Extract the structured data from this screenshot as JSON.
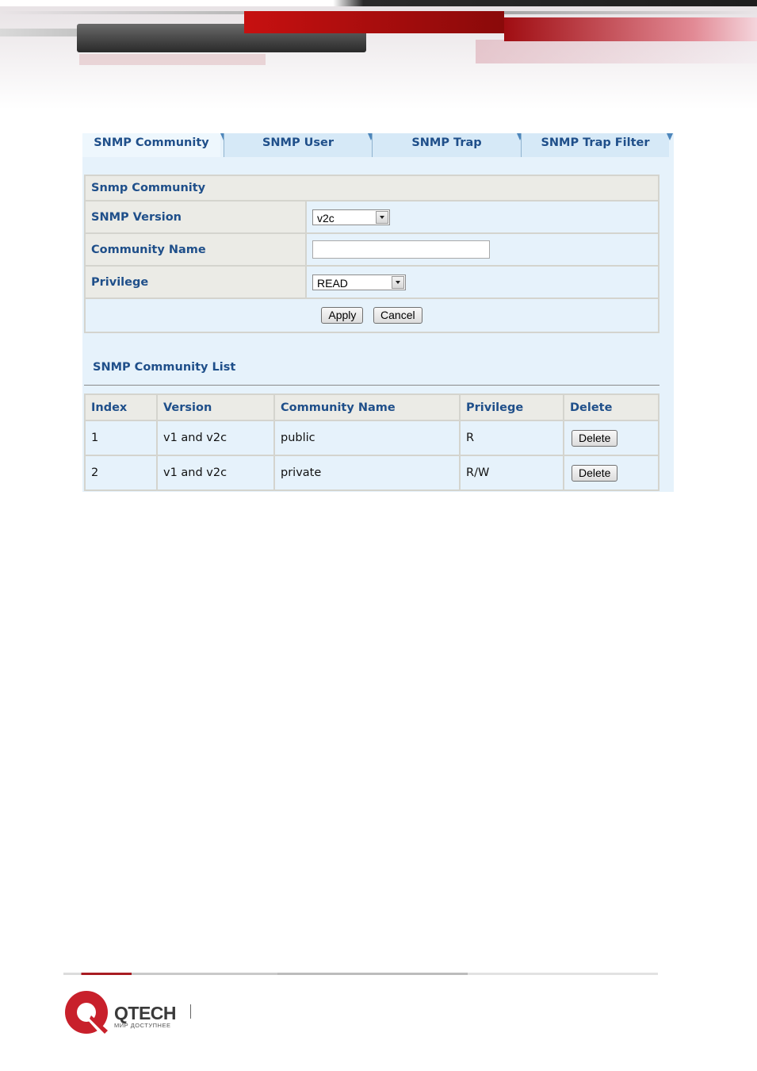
{
  "tabs": [
    {
      "label": "SNMP Community",
      "active": true
    },
    {
      "label": "SNMP User",
      "active": false
    },
    {
      "label": "SNMP Trap",
      "active": false
    },
    {
      "label": "SNMP Trap Filter",
      "active": false
    }
  ],
  "form": {
    "section_title": "Snmp Community",
    "version_label": "SNMP Version",
    "version_value": "v2c",
    "community_label": "Community Name",
    "community_value": "",
    "privilege_label": "Privilege",
    "privilege_value": "READ",
    "apply_label": "Apply",
    "cancel_label": "Cancel"
  },
  "list": {
    "title": "SNMP Community List",
    "columns": [
      "Index",
      "Version",
      "Community Name",
      "Privilege",
      "Delete"
    ],
    "rows": [
      {
        "index": "1",
        "version": "v1 and v2c",
        "community": "public",
        "privilege": "R",
        "delete_label": "Delete"
      },
      {
        "index": "2",
        "version": "v1 and v2c",
        "community": "private",
        "privilege": "R/W",
        "delete_label": "Delete"
      }
    ]
  },
  "footer": {
    "brand": "QTECH",
    "tagline": "МИР ДОСТУПНЕЕ",
    "colors": {
      "brand_red": "#c8202b",
      "tab_text": "#1f4f8a"
    }
  }
}
